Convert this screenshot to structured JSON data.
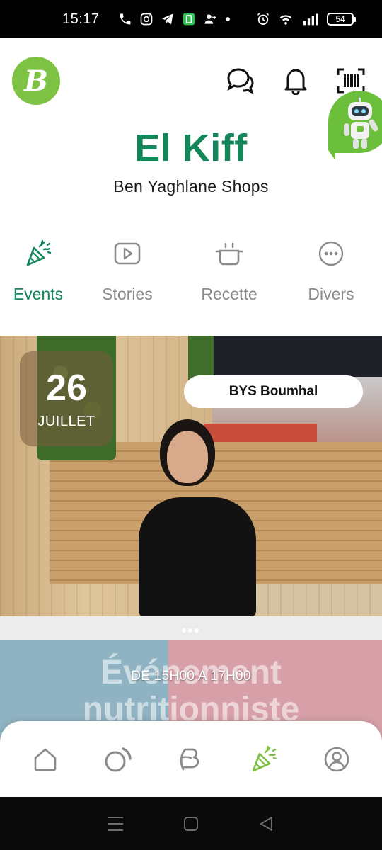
{
  "status_bar": {
    "time": "15:17",
    "battery": "54",
    "left_icons": [
      "phone-icon",
      "instagram-icon",
      "telegram-icon",
      "app-icon",
      "add-user-icon",
      "dot-icon"
    ],
    "right_icons": [
      "alarm-icon",
      "wifi-icon",
      "signal-icon",
      "battery-icon"
    ]
  },
  "header": {
    "logo_letter": "B",
    "actions": [
      "chat-icon",
      "bell-icon",
      "barcode-scan-icon"
    ],
    "assistant": "robot-assistant-icon"
  },
  "brand": {
    "title": "El Kiff",
    "subtitle": "Ben Yaghlane Shops",
    "accent_color": "#13875a",
    "logo_color": "#7dc242"
  },
  "tabs": [
    {
      "label": "Events",
      "icon": "party-popper-icon",
      "active": true
    },
    {
      "label": "Stories",
      "icon": "play-icon",
      "active": false
    },
    {
      "label": "Recette",
      "icon": "cooking-pot-icon",
      "active": false
    },
    {
      "label": "Divers",
      "icon": "more-horizontal-icon",
      "active": false
    }
  ],
  "event": {
    "day": "26",
    "month": "JUILLET",
    "store": "BYS Boumhal",
    "dots": "•••",
    "time_range": "DE 15H00 A 17H00",
    "image_text": "Événement nutritionniste"
  },
  "bottom_nav": [
    {
      "name": "home",
      "icon": "home-icon",
      "active": false
    },
    {
      "name": "circle",
      "icon": "circle-icon",
      "active": false
    },
    {
      "name": "brand",
      "icon": "brand-b-icon",
      "active": false
    },
    {
      "name": "events",
      "icon": "party-popper-icon",
      "active": true
    },
    {
      "name": "profile",
      "icon": "profile-icon",
      "active": false
    }
  ],
  "system_nav": [
    "menu-icon",
    "home-square-icon",
    "back-icon"
  ]
}
